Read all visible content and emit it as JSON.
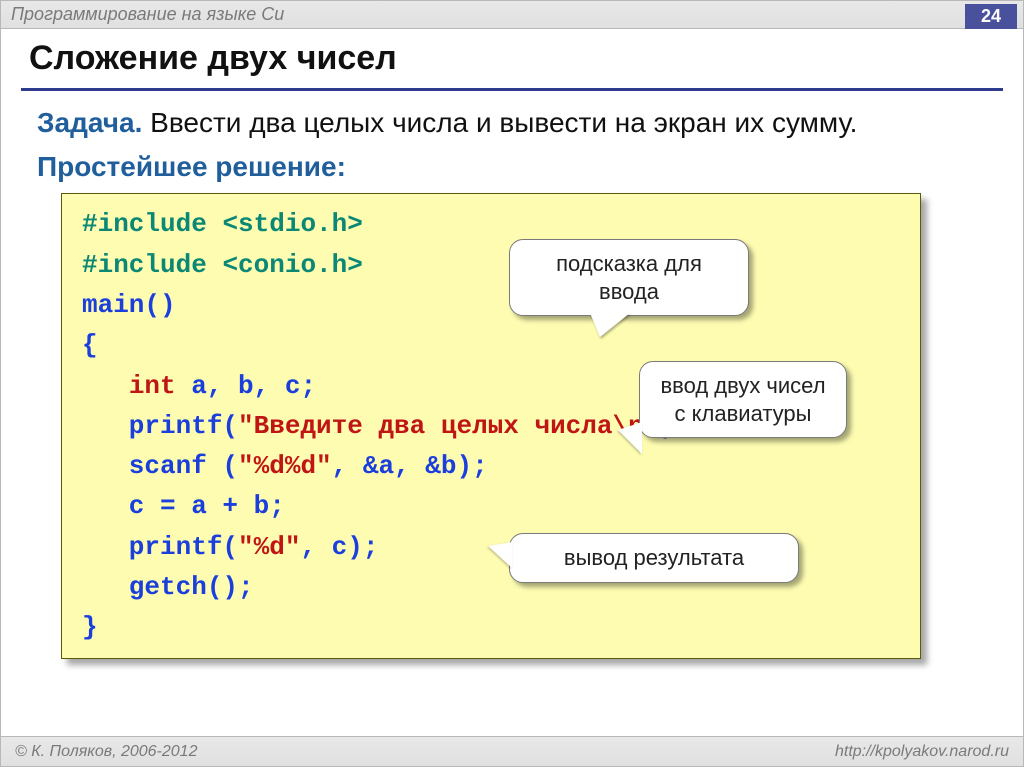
{
  "header": {
    "top_title": "Программирование на языке Си",
    "page_number": "24",
    "title": "Сложение двух чисел"
  },
  "task": {
    "label": "Задача.",
    "text": " Ввести два целых числа и вывести на экран их сумму."
  },
  "solution_label": "Простейшее решение:",
  "code": {
    "l1a": "#include ",
    "l1b": "<stdio.h>",
    "l2a": "#include ",
    "l2b": "<conio.h>",
    "l3": "main()",
    "l4": "{",
    "l5a": "   ",
    "l5b": "int",
    "l5c": " a, b, c;",
    "l6a": "   printf(",
    "l6b": "\"Введите два целых числа\\n\"",
    "l6c": ");",
    "l7a": "   scanf (",
    "l7b": "\"%d%d\"",
    "l7c": ", &a, &b);",
    "l8": "   c = a + b;",
    "l9a": "   printf(",
    "l9b": "\"%d\"",
    "l9c": ", c);",
    "l10": "   getch();",
    "l11": "}"
  },
  "callouts": {
    "c1": "подсказка для ввода",
    "c2": "ввод двух чисел с клавиатуры",
    "c3": "вывод результата"
  },
  "footer": {
    "left": "© К. Поляков, 2006-2012",
    "right": "http://kpolyakov.narod.ru"
  }
}
